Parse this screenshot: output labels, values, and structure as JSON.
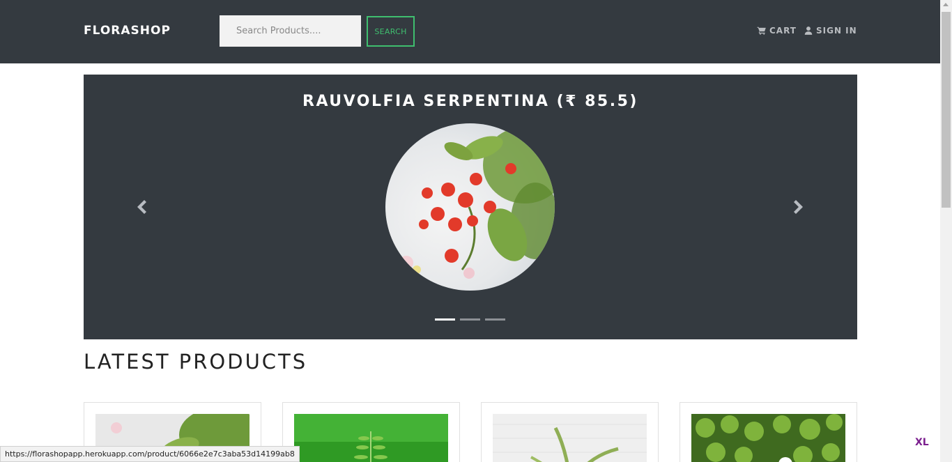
{
  "navbar": {
    "brand": "FLORASHOP",
    "search_placeholder": "Search Products....",
    "search_button": "SEARCH",
    "cart_label": "CART",
    "signin_label": "SIGN IN",
    "cart_icon": "cart-icon",
    "signin_icon": "user-icon",
    "accent_color": "#3fbf6f",
    "background_color": "#343a40"
  },
  "carousel": {
    "caption": "RAUVOLFIA SERPENTINA (₹ 85.5)",
    "prev_icon": "chevron-left-icon",
    "next_icon": "chevron-right-icon",
    "slide_count": 3,
    "active_slide": 1
  },
  "latest": {
    "title": "LATEST PRODUCTS",
    "card_count": 4
  },
  "status_bar": {
    "url": "https://florashopapp.herokuapp.com/product/6066e2e7c3aba53d14199ab8"
  },
  "badge": {
    "text": "XL"
  }
}
